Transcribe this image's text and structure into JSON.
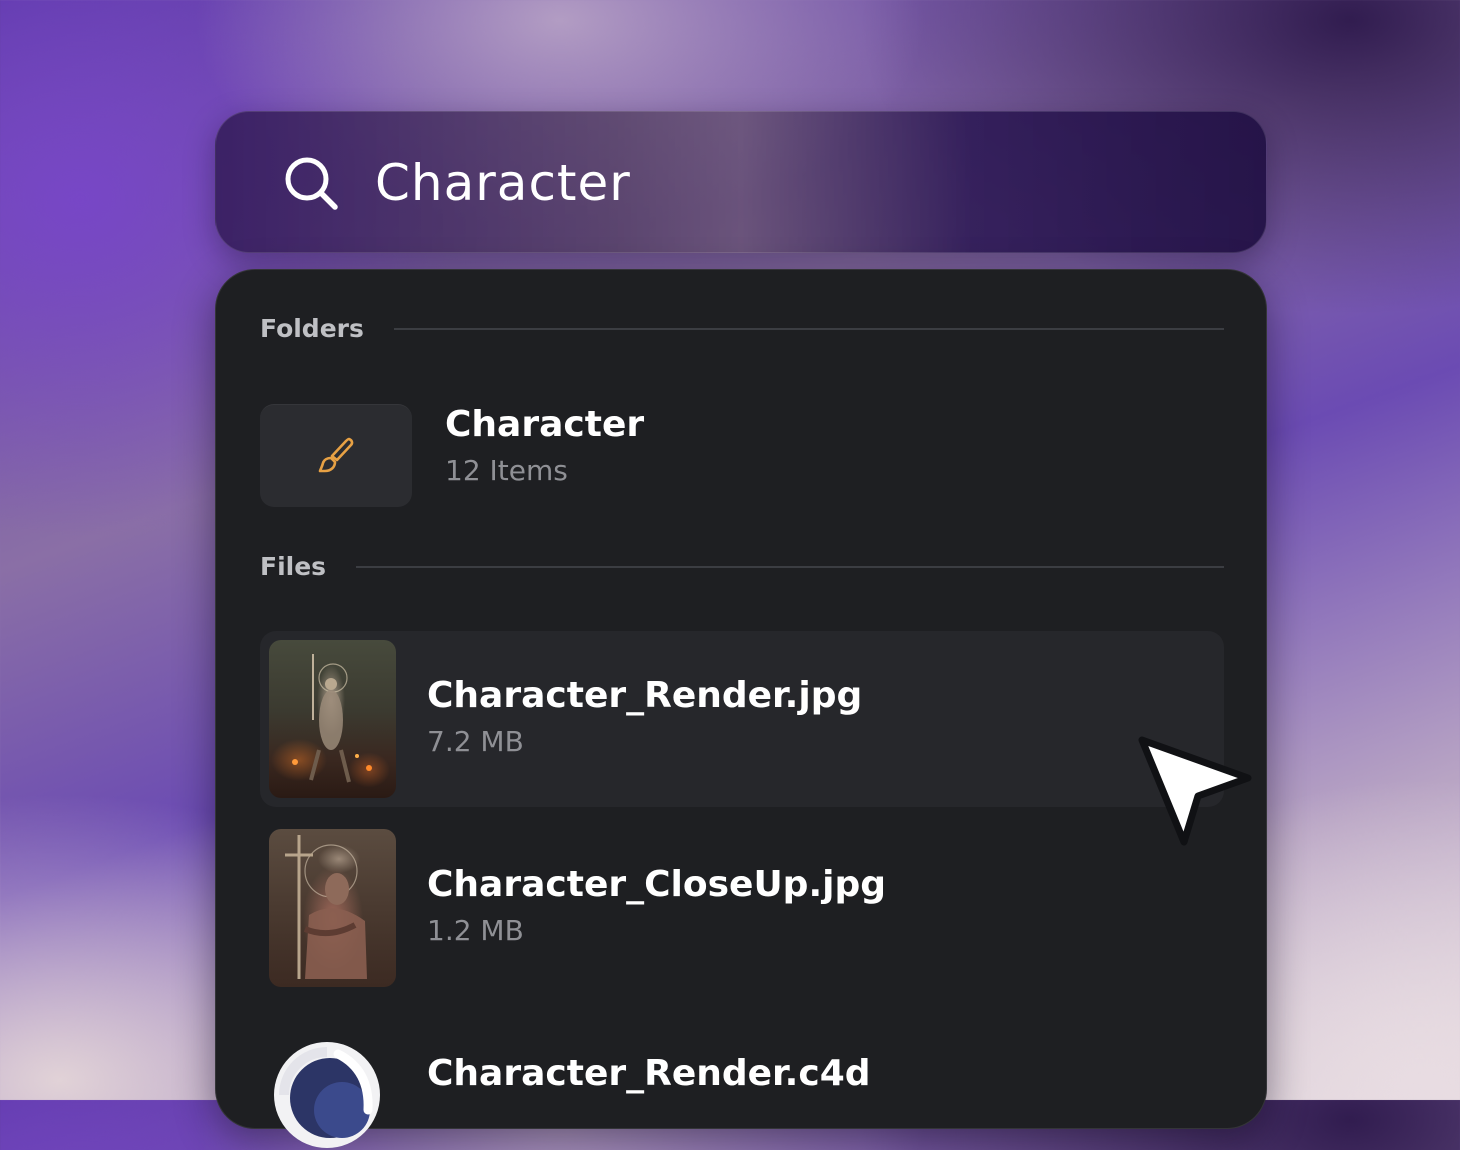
{
  "search": {
    "query": "Character",
    "icon": "search-icon"
  },
  "folders": {
    "header": "Folders",
    "items": [
      {
        "name": "Character",
        "meta": "12 Items",
        "icon": "paintbrush-icon",
        "icon_color": "#e7a144"
      }
    ]
  },
  "files": {
    "header": "Files",
    "items": [
      {
        "name": "Character_Render.jpg",
        "meta": "7.2 MB",
        "selected": true
      },
      {
        "name": "Character_CloseUp.jpg",
        "meta": "1.2 MB",
        "selected": false
      },
      {
        "name": "Character_Render.c4d",
        "meta": "",
        "icon": "cinema4d-icon"
      }
    ]
  },
  "colors": {
    "panel_bg": "#1e1f22",
    "selected_row_bg": "#26272b",
    "accent_icon": "#e7a144"
  }
}
